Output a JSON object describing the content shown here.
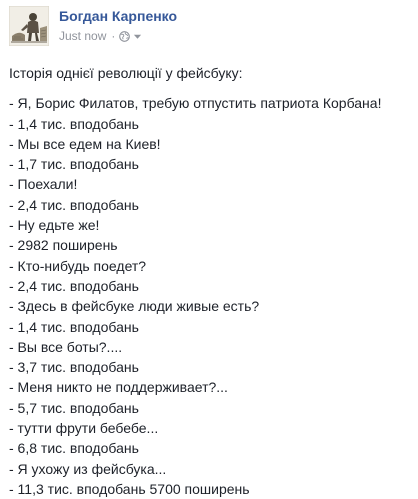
{
  "post": {
    "author": "Богдан Карпенко",
    "timestamp": "Just now",
    "separator": "·",
    "privacy_icon": "globe-icon",
    "menu_icon": "chevron-down-icon",
    "colors": {
      "author": "#365899",
      "meta": "#90949c",
      "text": "#1d2129"
    },
    "intro": "Історія однієї революції у фейсбуку:",
    "lines": [
      "- Я, Борис Филатов, требую отпустить патриота Корбана!",
      "- 1,4 тис. вподобань",
      "- Мы все едем на Киев!",
      "- 1,7 тис. вподобань",
      "- Поехали!",
      "- 2,4 тис. вподобань",
      "- Ну едьте же!",
      "- 2982 поширень",
      "- Кто-нибудь поедет?",
      "- 2,4 тис. вподобань",
      "- Здесь в фейсбуке люди живые есть?",
      "- 1,4 тис. вподобань",
      "- Вы все боты?....",
      "- 3,7 тис. вподобань",
      "- Меня никто не поддерживает?...",
      "- 5,7 тис. вподобань",
      "- тутти фрути бебебе...",
      "- 6,8 тис. вподобань",
      "- Я ухожу из фейсбука...",
      "- 11,3 тис. вподобань 5700 поширень"
    ]
  }
}
